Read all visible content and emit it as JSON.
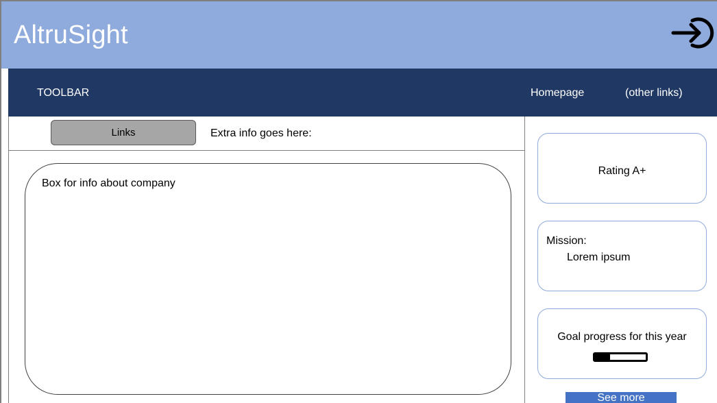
{
  "header": {
    "title": "AltruSight",
    "login_icon": "sign-in-icon"
  },
  "toolbar": {
    "label": "TOOLBAR",
    "links": [
      "Homepage",
      "(other links)"
    ]
  },
  "info_bar": {
    "links_button": "Links",
    "extra_info": "Extra info goes here:"
  },
  "company_box": {
    "text": "Box for info about company"
  },
  "sidebar": {
    "rating": "Rating A+",
    "mission_label": "Mission:",
    "mission_text": "Lorem ipsum",
    "goal_text": "Goal progress for this year",
    "goal_progress": 0.3,
    "see_more": "See more"
  },
  "colors": {
    "header_bg": "#8faadc",
    "toolbar_bg": "#203864",
    "button_accent": "#4472c4"
  }
}
